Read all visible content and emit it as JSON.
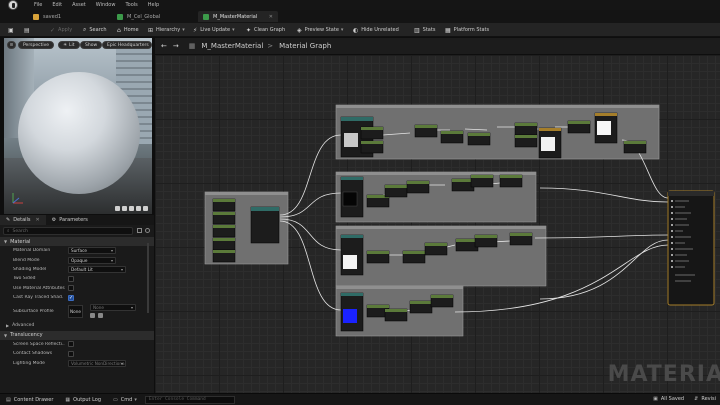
{
  "menubar": {
    "items": [
      "File",
      "Edit",
      "Asset",
      "Window",
      "Tools",
      "Help"
    ]
  },
  "tabs": [
    {
      "label": "saved1",
      "color": "#d9a33a",
      "active": false
    },
    {
      "label": "M_Cel_Global",
      "color": "#3c9a4a",
      "active": false
    },
    {
      "label": "M_MasterMaterial",
      "color": "#3c9a4a",
      "active": true
    }
  ],
  "toolbar": {
    "save_icon": "save-icon",
    "browse_icon": "folder-icon",
    "apply_label": "Apply",
    "search_label": "Search",
    "home_label": "Home",
    "hierarchy_label": "Hierarchy",
    "live_update_label": "Live Update",
    "clean_graph_label": "Clean Graph",
    "preview_state_label": "Preview State",
    "hide_unrelated_label": "Hide Unrelated",
    "stats_label": "Stats",
    "platform_stats_label": "Platform Stats"
  },
  "viewport": {
    "mode_label": "Perspective",
    "lit_label": "Lit",
    "show_label": "Show",
    "mesh_label": "Epic Headquarters"
  },
  "details": {
    "tab_details": "Details",
    "tab_parameters": "Parameters",
    "search_placeholder": "Search",
    "section_material": "Material",
    "material_domain_label": "Material Domain",
    "material_domain_value": "Surface",
    "blend_mode_label": "Blend Mode",
    "blend_mode_value": "Opaque",
    "shading_model_label": "Shading Model",
    "shading_model_value": "Default Lit",
    "two_sided_label": "Two Sided",
    "use_material_attributes_label": "Use Material Attributes",
    "cast_ray_traced_shadows_label": "Cast Ray Traced Shad.",
    "subsurface_profile_label": "Subsurface Profile",
    "subsurface_none": "None",
    "subsurface_combo": "None",
    "section_advanced": "Advanced",
    "section_translucency": "Translucency",
    "screen_space_reflections_label": "Screen Space Reflecti..",
    "contact_shadows_label": "Contact Shadows",
    "lighting_mode_label": "Lighting Mode",
    "lighting_mode_value": "Volumetric NonDirectional"
  },
  "graph": {
    "breadcrumb_root": "M_MasterMaterial",
    "breadcrumb_current": "Material Graph",
    "watermark": "MATERIA"
  },
  "statusbar": {
    "content_drawer": "Content Drawer",
    "output_log": "Output Log",
    "cmd": "Cmd",
    "console_placeholder": "Enter Console Command",
    "all_saved": "All Saved",
    "revision": "Revisi"
  },
  "colors": {
    "node_header_green": "#5b7a3a",
    "node_header_teal": "#2f6b66",
    "node_header_gold": "#a57e2a",
    "comment_box": "#8a8a8a",
    "wire": "#e8e8e8",
    "preview_blue": "#1a22ff"
  }
}
